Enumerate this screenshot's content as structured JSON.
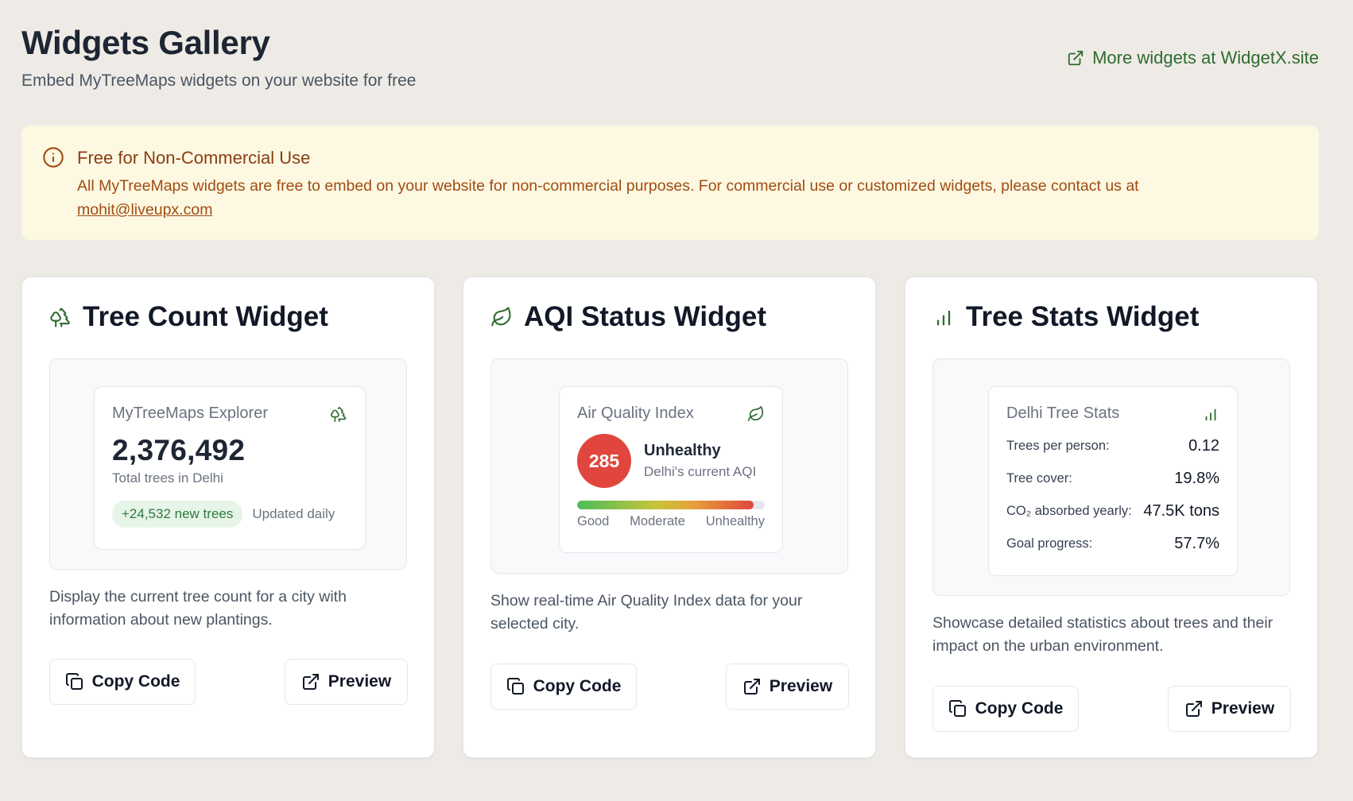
{
  "header": {
    "title": "Widgets Gallery",
    "subtitle": "Embed MyTreeMaps widgets on your website for free",
    "external_link": "More widgets at WidgetX.site"
  },
  "notice": {
    "title": "Free for Non-Commercial Use",
    "body": "All MyTreeMaps widgets are free to embed on your website for non-commercial purposes. For commercial use or customized widgets, please contact us at",
    "email": "mohit@liveupx.com"
  },
  "widgets": [
    {
      "title": "Tree Count Widget",
      "icon": "trees-icon",
      "preview": {
        "label": "MyTreeMaps Explorer",
        "number": "2,376,492",
        "sub": "Total trees in Delhi",
        "badge": "+24,532 new trees",
        "updated": "Updated daily"
      },
      "description": "Display the current tree count for a city with information about new plantings.",
      "copy_label": "Copy Code",
      "preview_label": "Preview"
    },
    {
      "title": "AQI Status Widget",
      "icon": "leaf-icon",
      "preview": {
        "label": "Air Quality Index",
        "value": "285",
        "status": "Unhealthy",
        "sub": "Delhi's current AQI",
        "bar_level": 0.94,
        "scale": [
          "Good",
          "Moderate",
          "Unhealthy"
        ]
      },
      "description": "Show real-time Air Quality Index data for your selected city.",
      "copy_label": "Copy Code",
      "preview_label": "Preview"
    },
    {
      "title": "Tree Stats Widget",
      "icon": "bar-chart-icon",
      "preview": {
        "label": "Delhi Tree Stats",
        "rows": [
          {
            "label": "Trees per person:",
            "value": "0.12"
          },
          {
            "label": "Tree cover:",
            "value": "19.8%"
          },
          {
            "label": "CO₂ absorbed yearly:",
            "value": "47.5K tons"
          },
          {
            "label": "Goal progress:",
            "value": "57.7%"
          }
        ]
      },
      "description": "Showcase detailed statistics about trees and their impact on the urban environment.",
      "copy_label": "Copy Code",
      "preview_label": "Preview"
    }
  ],
  "colors": {
    "accent_green": "#2f6b2f",
    "notice_bg": "#fdf8e2",
    "notice_text": "#a04c12",
    "aqi_red": "#e0463e"
  }
}
